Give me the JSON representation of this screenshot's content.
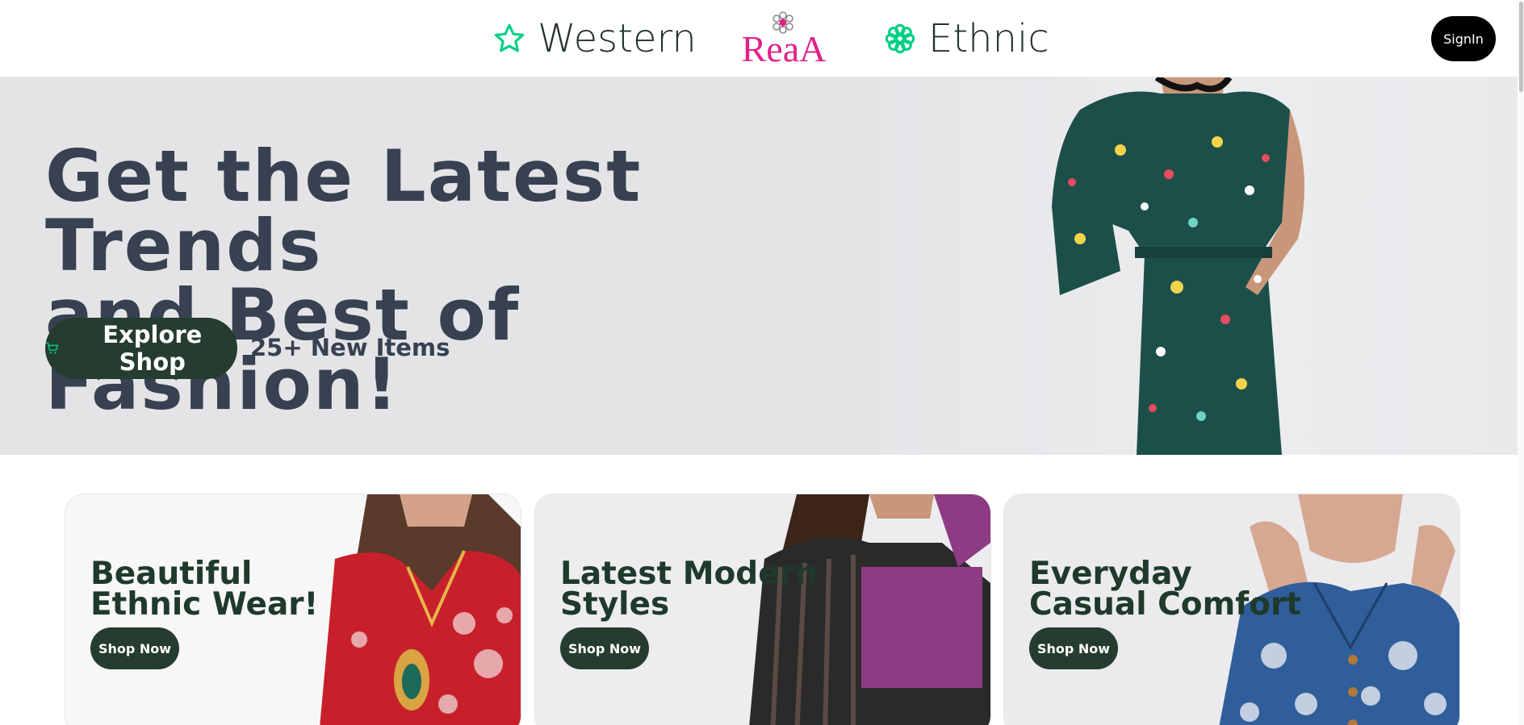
{
  "header": {
    "nav_western": "Western",
    "nav_ethnic": "Ethnic",
    "logo_text": "ReaA",
    "signin_label": "SignIn"
  },
  "hero": {
    "title_line1": "Get the Latest Trends",
    "title_line2": "and Best of Fashion!",
    "explore_label": "Explore Shop",
    "new_items": "25+ New Items"
  },
  "cards": [
    {
      "title": "Beautiful Ethnic Wear!",
      "button": "Shop Now"
    },
    {
      "title": "Latest Modern Styles",
      "button": "Shop Now"
    },
    {
      "title": "Everyday Casual Comfort",
      "button": "Shop Now"
    }
  ],
  "colors": {
    "accent_green": "#00d084",
    "dark_green": "#253c2f",
    "logo_pink": "#e0218a",
    "hero_bg": "#e4e4e6",
    "heading": "#374151"
  },
  "icons": [
    "star-icon",
    "flower-icon",
    "cart-icon"
  ]
}
